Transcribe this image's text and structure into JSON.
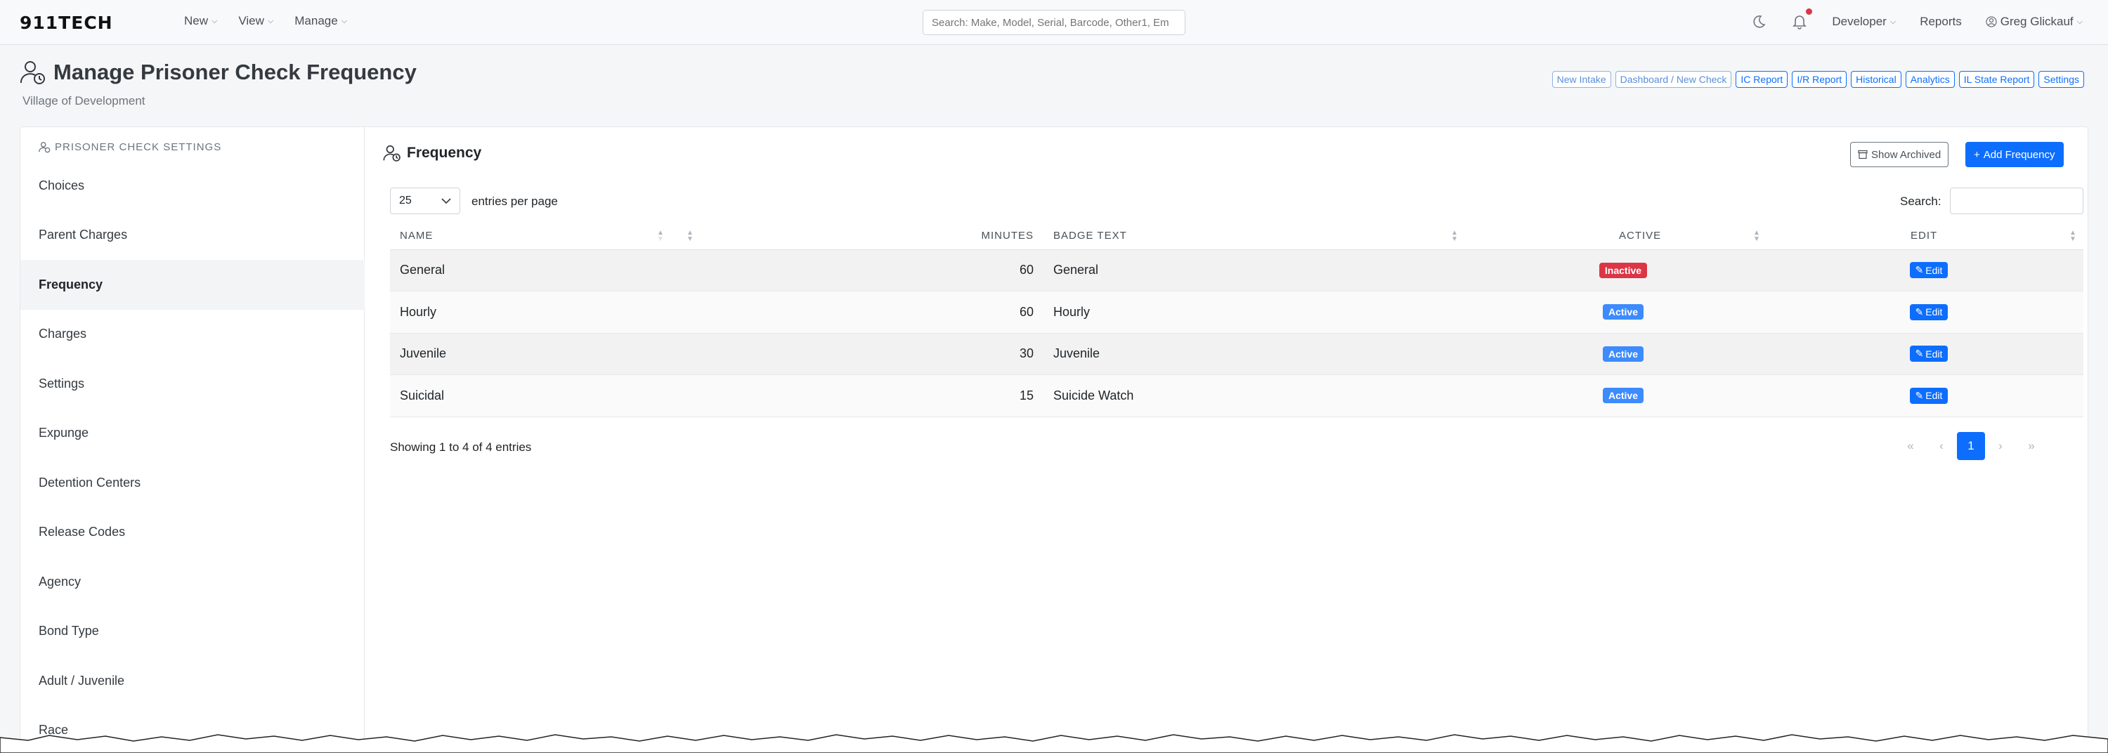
{
  "nav": {
    "brand": "911TECH",
    "menus": [
      {
        "label": "New"
      },
      {
        "label": "View"
      },
      {
        "label": "Manage"
      }
    ],
    "search_placeholder": "Search: Make, Model, Serial, Barcode, Other1, Em",
    "developer": "Developer",
    "reports": "Reports",
    "user": "Greg Glickauf"
  },
  "page": {
    "title": "Manage Prisoner Check Frequency",
    "subtitle": "Village of Development",
    "quicklinks": [
      {
        "label": "New Intake",
        "muted": true
      },
      {
        "label": "Dashboard / New Check",
        "muted": true
      },
      {
        "label": "IC Report"
      },
      {
        "label": "I/R Report"
      },
      {
        "label": "Historical"
      },
      {
        "label": "Analytics"
      },
      {
        "label": "IL State Report"
      },
      {
        "label": "Settings"
      }
    ]
  },
  "sidebar": {
    "heading": "Prisoner Check Settings",
    "items": [
      {
        "label": "Choices"
      },
      {
        "label": "Parent Charges"
      },
      {
        "label": "Frequency",
        "active": true
      },
      {
        "label": "Charges"
      },
      {
        "label": "Settings"
      },
      {
        "label": "Expunge"
      },
      {
        "label": "Detention Centers"
      },
      {
        "label": "Release Codes"
      },
      {
        "label": "Agency"
      },
      {
        "label": "Bond Type"
      },
      {
        "label": "Adult / Juvenile"
      },
      {
        "label": "Race"
      }
    ]
  },
  "main": {
    "section_title": "Frequency",
    "show_archived": "Show Archived",
    "add_button": "Add Frequency",
    "page_length": "25",
    "entries_label": "entries per page",
    "search_label": "Search:",
    "columns": {
      "name": "Name",
      "minutes": "Minutes",
      "badge_text": "Badge Text",
      "active": "Active",
      "edit": "Edit"
    },
    "rows": [
      {
        "name": "General",
        "minutes": "60",
        "badge_text": "General",
        "status": "Inactive",
        "edit": "Edit"
      },
      {
        "name": "Hourly",
        "minutes": "60",
        "badge_text": "Hourly",
        "status": "Active",
        "edit": "Edit"
      },
      {
        "name": "Juvenile",
        "minutes": "30",
        "badge_text": "Juvenile",
        "status": "Active",
        "edit": "Edit"
      },
      {
        "name": "Suicidal",
        "minutes": "15",
        "badge_text": "Suicide Watch",
        "status": "Active",
        "edit": "Edit"
      }
    ],
    "info": "Showing 1 to 4 of 4 entries",
    "pager": {
      "first": "«",
      "prev": "‹",
      "current": "1",
      "next": "›",
      "last": "»"
    }
  },
  "colors": {
    "primary": "#0d6efd",
    "danger": "#dc3545",
    "active_badge": "#3d8bfd"
  }
}
